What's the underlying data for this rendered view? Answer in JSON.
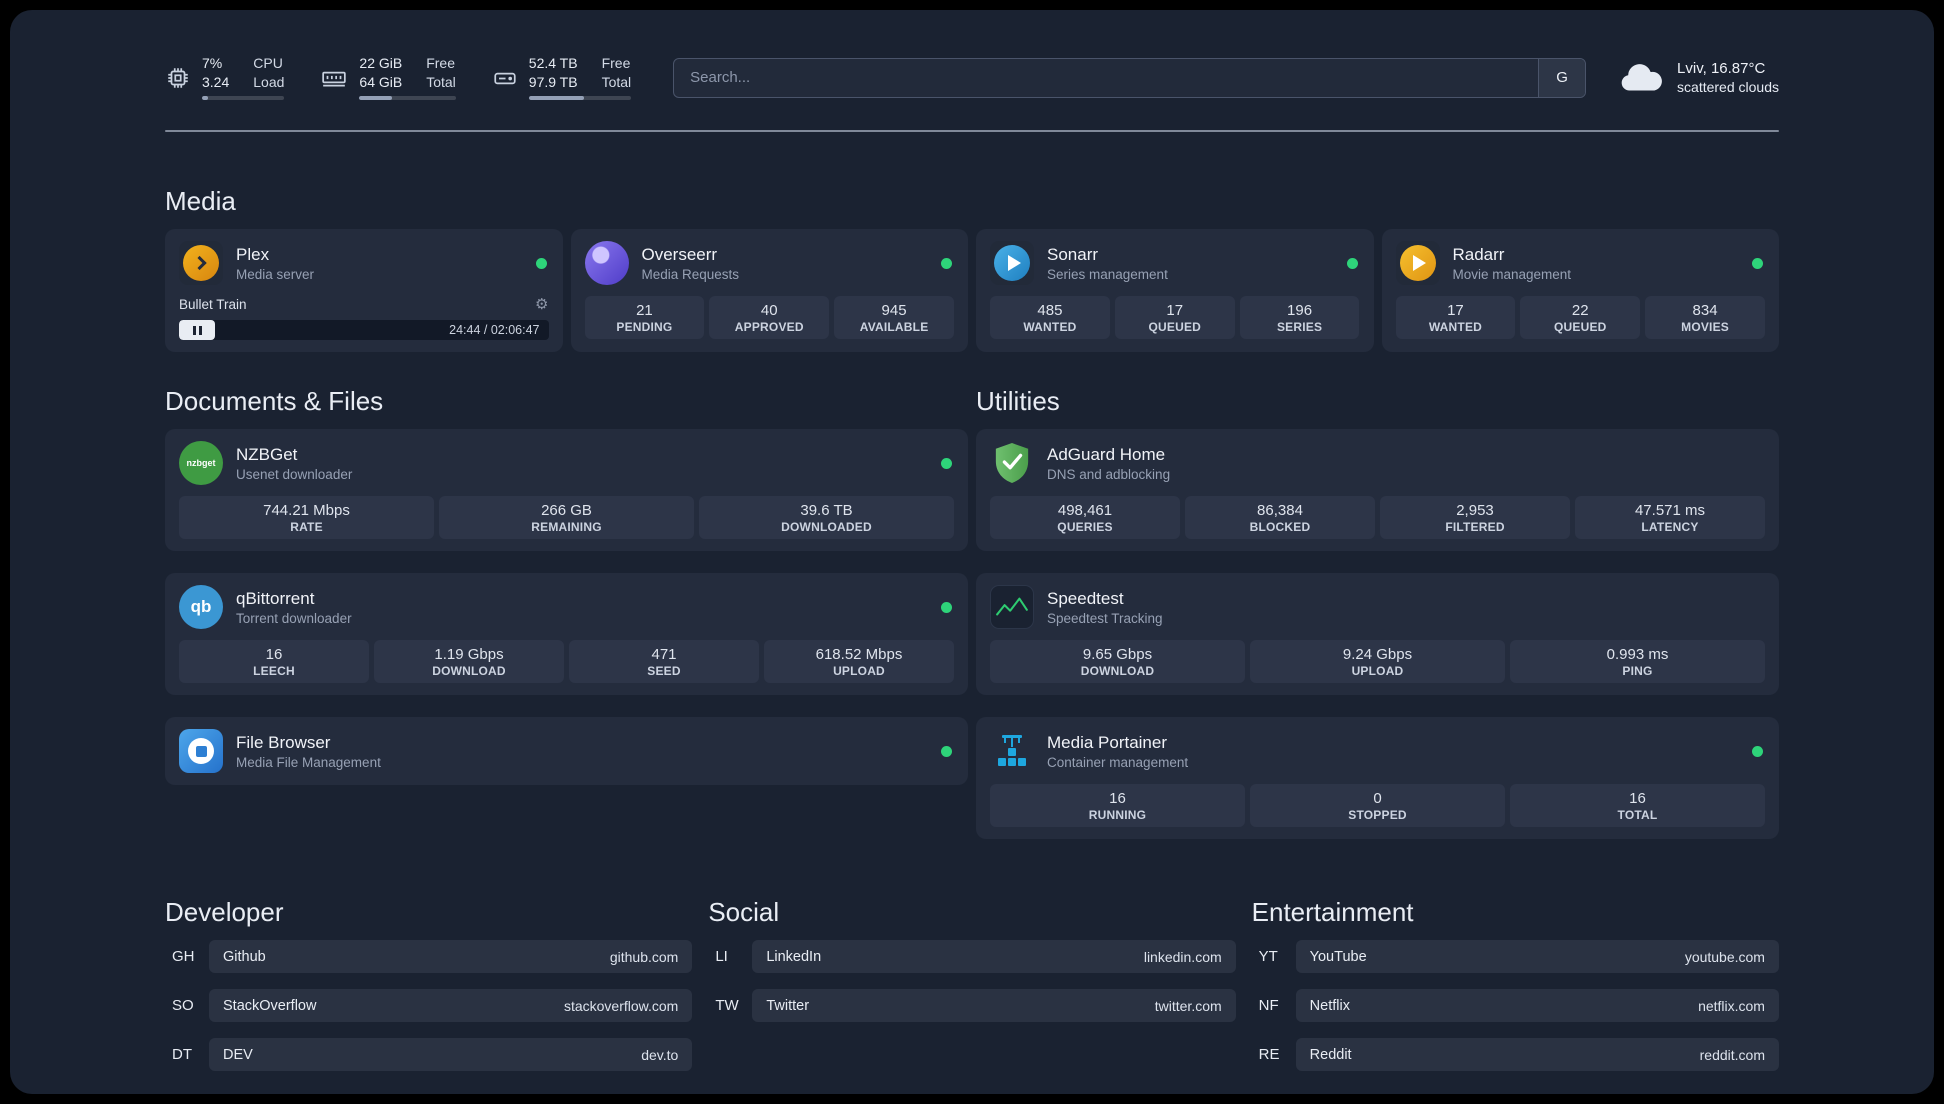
{
  "colors": {
    "status_online": "#2ed47a",
    "page_background": "#1a2231",
    "card_background": "#242c3d",
    "tile_background": "#2d3548"
  },
  "icons": {
    "gear": "⚙"
  },
  "topbar": {
    "cpu": {
      "values": [
        "7%",
        "3.24"
      ],
      "labels": [
        "CPU",
        "Load"
      ]
    },
    "ram": {
      "values": [
        "22 GiB",
        "64 GiB"
      ],
      "labels": [
        "Free",
        "Total"
      ]
    },
    "disk": {
      "values": [
        "52.4 TB",
        "97.9 TB"
      ],
      "labels": [
        "Free",
        "Total"
      ]
    },
    "search": {
      "placeholder": "Search...",
      "engine_button": "G"
    },
    "weather": {
      "location": "Lviv, 16.87°C",
      "condition": "scattered clouds"
    }
  },
  "media": {
    "title": "Media",
    "apps": [
      {
        "name": "Plex",
        "subtitle": "Media server",
        "player": {
          "track": "Bullet Train",
          "time": "24:44 / 02:06:47"
        }
      },
      {
        "name": "Overseerr",
        "subtitle": "Media Requests",
        "stats": [
          {
            "value": "21",
            "label": "PENDING"
          },
          {
            "value": "40",
            "label": "APPROVED"
          },
          {
            "value": "945",
            "label": "AVAILABLE"
          }
        ]
      },
      {
        "name": "Sonarr",
        "subtitle": "Series management",
        "stats": [
          {
            "value": "485",
            "label": "WANTED"
          },
          {
            "value": "17",
            "label": "QUEUED"
          },
          {
            "value": "196",
            "label": "SERIES"
          }
        ]
      },
      {
        "name": "Radarr",
        "subtitle": "Movie management",
        "stats": [
          {
            "value": "17",
            "label": "WANTED"
          },
          {
            "value": "22",
            "label": "QUEUED"
          },
          {
            "value": "834",
            "label": "MOVIES"
          }
        ]
      }
    ]
  },
  "documents": {
    "title": "Documents & Files",
    "apps": [
      {
        "name": "NZBGet",
        "subtitle": "Usenet downloader",
        "icon_text": "nzbget",
        "stats": [
          {
            "value": "744.21 Mbps",
            "label": "RATE"
          },
          {
            "value": "266 GB",
            "label": "REMAINING"
          },
          {
            "value": "39.6 TB",
            "label": "DOWNLOADED"
          }
        ]
      },
      {
        "name": "qBittorrent",
        "subtitle": "Torrent downloader",
        "icon_text": "qb",
        "stats": [
          {
            "value": "16",
            "label": "LEECH"
          },
          {
            "value": "1.19 Gbps",
            "label": "DOWNLOAD"
          },
          {
            "value": "471",
            "label": "SEED"
          },
          {
            "value": "618.52 Mbps",
            "label": "UPLOAD"
          }
        ]
      },
      {
        "name": "File Browser",
        "subtitle": "Media File Management"
      }
    ]
  },
  "utilities": {
    "title": "Utilities",
    "apps": [
      {
        "name": "AdGuard Home",
        "subtitle": "DNS and adblocking",
        "stats": [
          {
            "value": "498,461",
            "label": "QUERIES"
          },
          {
            "value": "86,384",
            "label": "BLOCKED"
          },
          {
            "value": "2,953",
            "label": "FILTERED"
          },
          {
            "value": "47.571 ms",
            "label": "LATENCY"
          }
        ]
      },
      {
        "name": "Speedtest",
        "subtitle": "Speedtest Tracking",
        "stats": [
          {
            "value": "9.65 Gbps",
            "label": "DOWNLOAD"
          },
          {
            "value": "9.24 Gbps",
            "label": "UPLOAD"
          },
          {
            "value": "0.993 ms",
            "label": "PING"
          }
        ]
      },
      {
        "name": "Media Portainer",
        "subtitle": "Container management",
        "stats": [
          {
            "value": "16",
            "label": "RUNNING"
          },
          {
            "value": "0",
            "label": "STOPPED"
          },
          {
            "value": "16",
            "label": "TOTAL"
          }
        ]
      }
    ]
  },
  "links": {
    "developer": {
      "title": "Developer",
      "items": [
        {
          "abbr": "GH",
          "name": "Github",
          "url": "github.com"
        },
        {
          "abbr": "SO",
          "name": "StackOverflow",
          "url": "stackoverflow.com"
        },
        {
          "abbr": "DT",
          "name": "DEV",
          "url": "dev.to"
        }
      ]
    },
    "social": {
      "title": "Social",
      "items": [
        {
          "abbr": "LI",
          "name": "LinkedIn",
          "url": "linkedin.com"
        },
        {
          "abbr": "TW",
          "name": "Twitter",
          "url": "twitter.com"
        }
      ]
    },
    "entertainment": {
      "title": "Entertainment",
      "items": [
        {
          "abbr": "YT",
          "name": "YouTube",
          "url": "youtube.com"
        },
        {
          "abbr": "NF",
          "name": "Netflix",
          "url": "netflix.com"
        },
        {
          "abbr": "RE",
          "name": "Reddit",
          "url": "reddit.com"
        }
      ]
    }
  }
}
